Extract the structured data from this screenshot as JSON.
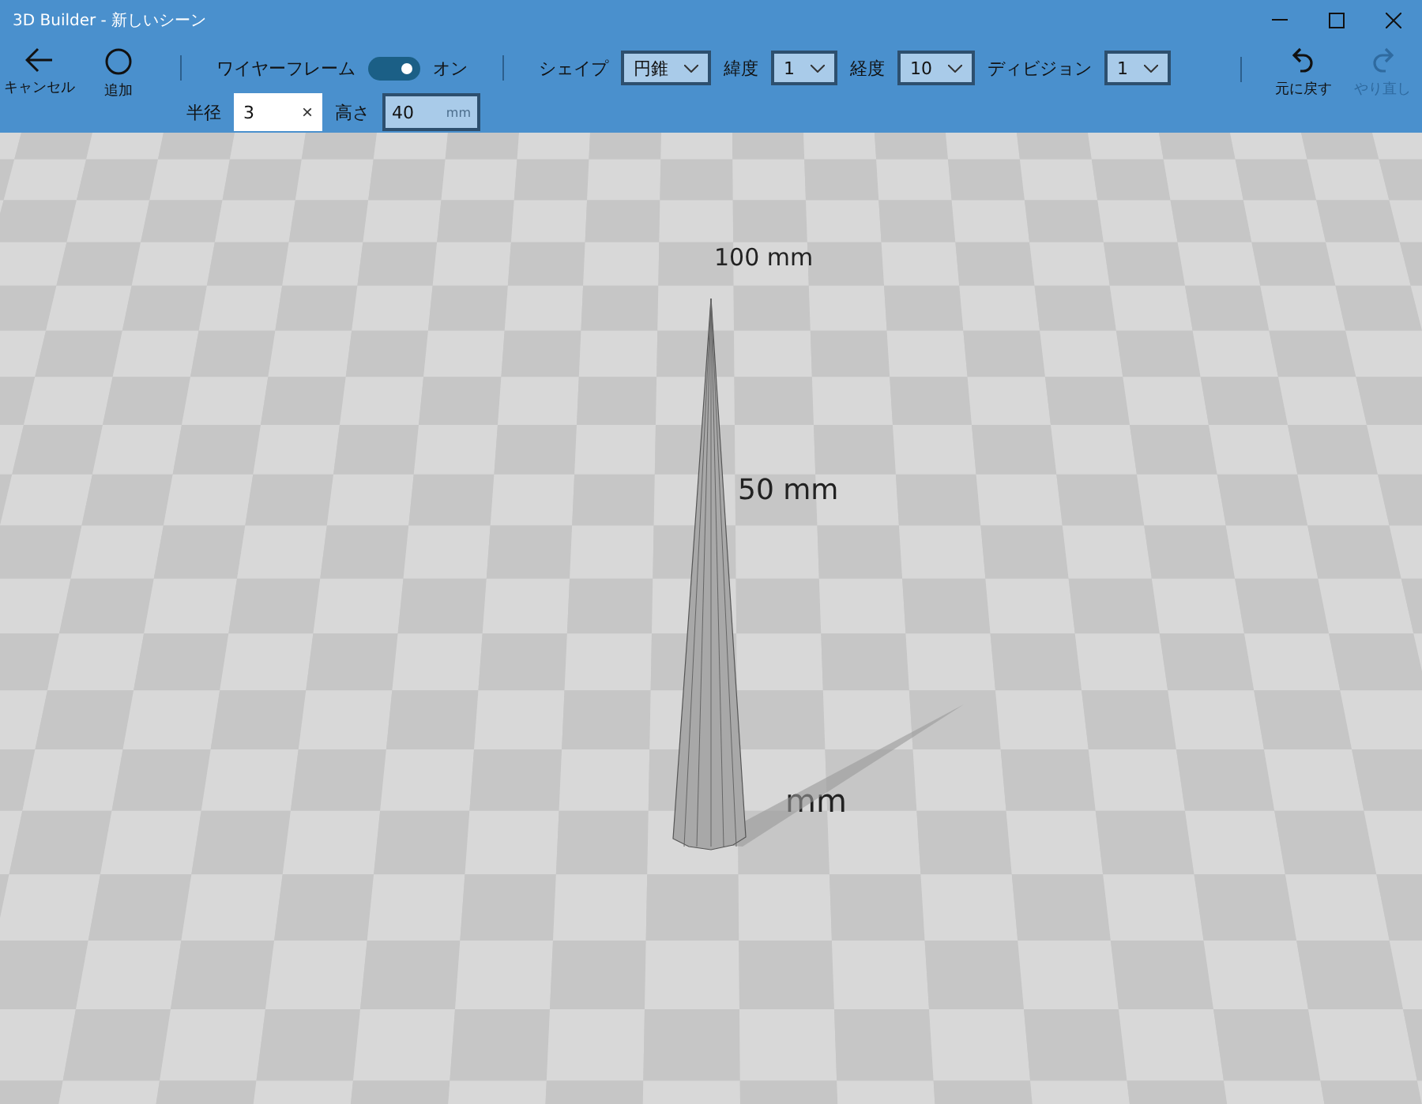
{
  "window": {
    "title": "3D Builder - 新しいシーン"
  },
  "toolbar": {
    "left_buttons": [
      {
        "kind": "back",
        "label": "キャンセル"
      },
      {
        "kind": "circle",
        "label": "追加"
      }
    ],
    "wireframe": {
      "label": "ワイヤーフレーム",
      "on": true,
      "state_label": "オン"
    },
    "dropdowns": [
      {
        "label": "シェイプ",
        "value": "円錐"
      },
      {
        "label": "緯度",
        "value": "1"
      },
      {
        "label": "経度",
        "value": "10"
      },
      {
        "label": "ディビジョン",
        "value": "1"
      }
    ],
    "fields": [
      {
        "label": "半径",
        "value": "3",
        "disabled": false,
        "clear": "×"
      },
      {
        "label": "高さ",
        "value": "40",
        "disabled": true,
        "unit": "mm"
      }
    ],
    "right_buttons": [
      {
        "kind": "undo",
        "label": "元に戻す",
        "disabled": false
      },
      {
        "kind": "redo",
        "label": "やり直し",
        "disabled": true
      }
    ]
  },
  "viewport": {
    "labels": [
      "100 mm",
      "50 mm",
      "mm"
    ]
  }
}
